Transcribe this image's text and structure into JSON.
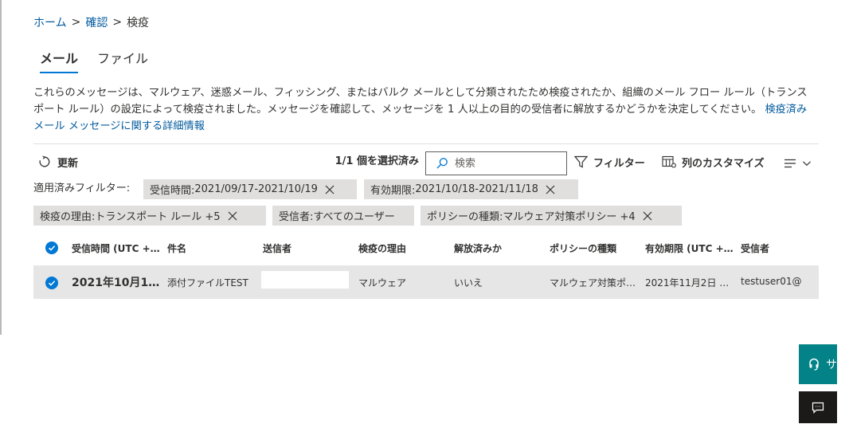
{
  "breadcrumb": {
    "home": "ホーム",
    "review": "確認",
    "current": "検疫",
    "sep": ">"
  },
  "tabs": [
    {
      "label": "メール",
      "active": true
    },
    {
      "label": "ファイル",
      "active": false
    }
  ],
  "description": {
    "text": "これらのメッセージは、マルウェア、迷惑メール、フィッシング、またはバルク メールとして分類されたため検疫されたか、組織のメール フロー ルール（トランスポート ルール）の設定によって検疫されました。メッセージを確認して、メッセージを 1 人以上の目的の受信者に解放するかどうかを決定してください。",
    "link": "検疫済みメール メッセージに関する詳細情報"
  },
  "toolbar": {
    "refresh": "更新",
    "selected_count": "1/1 個を選択済み",
    "search_placeholder": "検索",
    "filter": "フィルター",
    "customize_columns": "列のカスタマイズ"
  },
  "filters": {
    "label": "適用済みフィルター:",
    "chips": [
      {
        "key": "受信時間:",
        "value": " 2021/09/17-2021/10/19"
      },
      {
        "key": "有効期限:",
        "value": " 2021/10/18-2021/11/18"
      },
      {
        "key": "検疫の理由:",
        "value": " トランスポート ルール +5"
      },
      {
        "key": "受信者:",
        "value": " すべてのユーザー"
      },
      {
        "key": "ポリシーの種類:",
        "value": " マルウェア対策ポリシー +4"
      }
    ]
  },
  "table": {
    "columns": [
      "受信時間 (UTC +…",
      "件名",
      "送信者",
      "検疫の理由",
      "解放済みか",
      "ポリシーの種類",
      "有効期限 (UTC +…",
      "受信者"
    ],
    "rows": [
      {
        "selected": true,
        "received": "2021年10月1…",
        "subject": "添付ファイルTEST",
        "sender": "",
        "reason": "マルウェア",
        "released": "いいえ",
        "policy_type": "マルウェア対策ポ…",
        "expires": "2021年11月2日 0…",
        "recipient": "testuser01@"
      }
    ]
  },
  "help": {
    "label": "サ"
  },
  "colors": {
    "accent": "#0078d4",
    "link": "#005a9e",
    "help_bg": "#038387",
    "feedback_bg": "#1b1a19",
    "chip_bg": "#e1dfdd",
    "row_bg": "#e6e6e6"
  },
  "icons": {
    "refresh": "refresh-icon",
    "search": "search-icon",
    "filter": "filter-icon",
    "customize": "customize-columns-icon",
    "menu": "list-menu-icon",
    "chevron": "chevron-down-icon",
    "close": "close-icon",
    "check": "checkmark-icon",
    "headset": "headset-icon",
    "feedback": "feedback-icon"
  }
}
